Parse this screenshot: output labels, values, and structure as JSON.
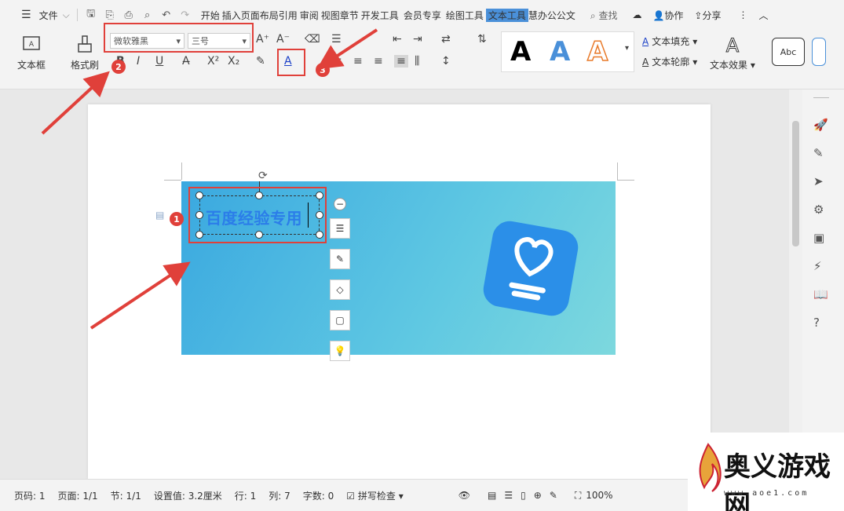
{
  "menubar": {
    "file": "文件",
    "tabs": [
      "开始",
      "插入",
      "页面布局",
      "引用",
      "审阅",
      "视图",
      "章节",
      "开发工具",
      "会员专享"
    ],
    "tab_draw": "绘图工具",
    "tab_text": "文本工具",
    "tab_last": "慧办公公文",
    "search": "查找",
    "collab": "协作",
    "share": "分享"
  },
  "ribbon": {
    "textbox_label": "文本框",
    "format_painter": "格式刷",
    "font_name": "微软雅黑",
    "font_size": "三号",
    "text_fill": "文本填充",
    "text_outline": "文本轮廓",
    "text_effect": "文本效果",
    "style_a": "A",
    "abc": "Abc"
  },
  "document": {
    "textbox_text": "百度经验专用"
  },
  "badges": [
    "1",
    "2",
    "3"
  ],
  "status": {
    "page_code": "页码: 1",
    "page": "页面: 1/1",
    "section": "节: 1/1",
    "setting": "设置值: 3.2厘米",
    "row": "行: 1",
    "col": "列: 7",
    "words": "字数: 0",
    "spellcheck": "拼写检查",
    "zoom": "100%"
  },
  "watermark": {
    "brand": "奥义游戏网",
    "url": "www.aoe1.com"
  },
  "colors": {
    "accent": "#2b7de9",
    "highlight_red": "#e0403a"
  }
}
